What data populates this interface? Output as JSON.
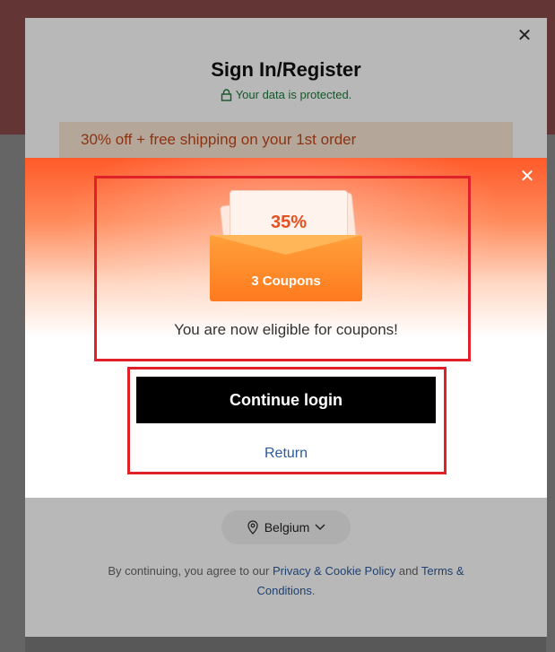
{
  "login_modal": {
    "title": "Sign In/Register",
    "protected_text": "Your data is protected.",
    "promo_text": "30% off + free shipping on your 1st order",
    "region": "Belgium",
    "terms": {
      "prefix": "By continuing, you agree to our ",
      "privacy_link": "Privacy & Cookie Policy",
      "and": " and ",
      "terms_link": "Terms & Conditions",
      "suffix": "."
    }
  },
  "coupon_popup": {
    "ticket_value": "35%",
    "coupons_label": "3 Coupons",
    "eligible_text": "You are now eligible for coupons!",
    "continue_label": "Continue login",
    "return_label": "Return"
  },
  "colors": {
    "highlight": "#e0212a",
    "accent_orange": "#ff7a1e",
    "link_blue": "#2a5a9e",
    "protect_green": "#1b7a3a"
  },
  "icons": {
    "close": "close-icon",
    "lock": "lock-icon",
    "location": "location-pin-icon",
    "chevron": "chevron-down-icon"
  }
}
